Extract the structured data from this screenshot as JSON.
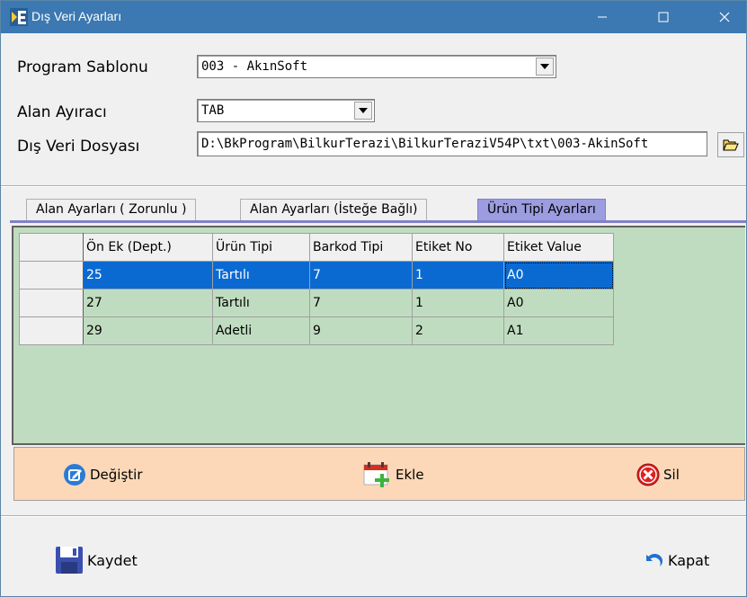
{
  "window": {
    "title": "Dış Veri Ayarları"
  },
  "form": {
    "program_label": "Program Sablonu",
    "program_value": "003 - AkınSoft",
    "separator_label": "Alan Ayıracı",
    "separator_value": "TAB",
    "file_label": "Dış Veri Dosyası",
    "file_value": "D:\\BkProgram\\BilkurTerazi\\BilkurTeraziV54P\\txt\\003-AkinSoft"
  },
  "tabs": [
    {
      "label": "Alan Ayarları ( Zorunlu )",
      "active": false
    },
    {
      "label": "Alan Ayarları (İsteğe Bağlı)",
      "active": false
    },
    {
      "label": "Ürün Tipi Ayarları",
      "active": true
    }
  ],
  "grid": {
    "columns": [
      "Ön Ek (Dept.)",
      "Ürün Tipi",
      "Barkod Tipi",
      "Etiket No",
      "Etiket Value"
    ],
    "rows": [
      [
        "25",
        "Tartılı",
        "7",
        "1",
        "A0"
      ],
      [
        "27",
        "Tartılı",
        "7",
        "1",
        "A0"
      ],
      [
        "29",
        "Adetli",
        "9",
        "2",
        "A1"
      ]
    ],
    "selected_row": 0
  },
  "actions": {
    "edit_label": "Değiştir",
    "add_label": "Ekle",
    "delete_label": "Sil"
  },
  "footer": {
    "save_label": "Kaydet",
    "close_label": "Kapat"
  },
  "colors": {
    "titlebar": "#3c78b2",
    "grid_bg": "#c0dcc0",
    "selection": "#0a6ad2",
    "action_bar": "#fcd8b8",
    "active_tab": "#9c9ce0"
  }
}
